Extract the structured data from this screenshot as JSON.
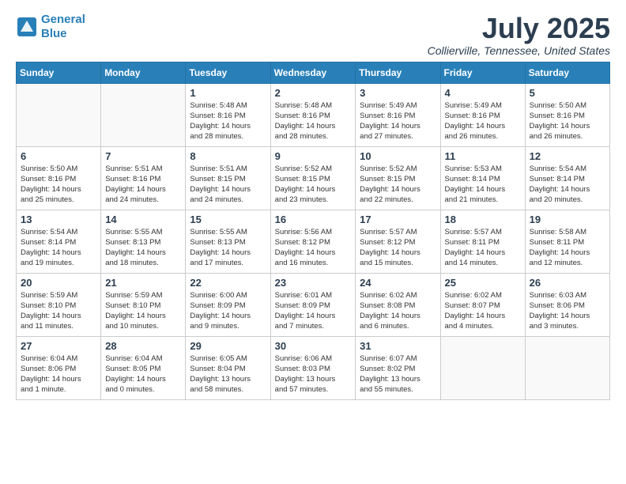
{
  "header": {
    "logo_line1": "General",
    "logo_line2": "Blue",
    "month_title": "July 2025",
    "location": "Collierville, Tennessee, United States"
  },
  "days_of_week": [
    "Sunday",
    "Monday",
    "Tuesday",
    "Wednesday",
    "Thursday",
    "Friday",
    "Saturday"
  ],
  "weeks": [
    [
      {
        "num": "",
        "info": ""
      },
      {
        "num": "",
        "info": ""
      },
      {
        "num": "1",
        "info": "Sunrise: 5:48 AM\nSunset: 8:16 PM\nDaylight: 14 hours\nand 28 minutes."
      },
      {
        "num": "2",
        "info": "Sunrise: 5:48 AM\nSunset: 8:16 PM\nDaylight: 14 hours\nand 28 minutes."
      },
      {
        "num": "3",
        "info": "Sunrise: 5:49 AM\nSunset: 8:16 PM\nDaylight: 14 hours\nand 27 minutes."
      },
      {
        "num": "4",
        "info": "Sunrise: 5:49 AM\nSunset: 8:16 PM\nDaylight: 14 hours\nand 26 minutes."
      },
      {
        "num": "5",
        "info": "Sunrise: 5:50 AM\nSunset: 8:16 PM\nDaylight: 14 hours\nand 26 minutes."
      }
    ],
    [
      {
        "num": "6",
        "info": "Sunrise: 5:50 AM\nSunset: 8:16 PM\nDaylight: 14 hours\nand 25 minutes."
      },
      {
        "num": "7",
        "info": "Sunrise: 5:51 AM\nSunset: 8:16 PM\nDaylight: 14 hours\nand 24 minutes."
      },
      {
        "num": "8",
        "info": "Sunrise: 5:51 AM\nSunset: 8:15 PM\nDaylight: 14 hours\nand 24 minutes."
      },
      {
        "num": "9",
        "info": "Sunrise: 5:52 AM\nSunset: 8:15 PM\nDaylight: 14 hours\nand 23 minutes."
      },
      {
        "num": "10",
        "info": "Sunrise: 5:52 AM\nSunset: 8:15 PM\nDaylight: 14 hours\nand 22 minutes."
      },
      {
        "num": "11",
        "info": "Sunrise: 5:53 AM\nSunset: 8:14 PM\nDaylight: 14 hours\nand 21 minutes."
      },
      {
        "num": "12",
        "info": "Sunrise: 5:54 AM\nSunset: 8:14 PM\nDaylight: 14 hours\nand 20 minutes."
      }
    ],
    [
      {
        "num": "13",
        "info": "Sunrise: 5:54 AM\nSunset: 8:14 PM\nDaylight: 14 hours\nand 19 minutes."
      },
      {
        "num": "14",
        "info": "Sunrise: 5:55 AM\nSunset: 8:13 PM\nDaylight: 14 hours\nand 18 minutes."
      },
      {
        "num": "15",
        "info": "Sunrise: 5:55 AM\nSunset: 8:13 PM\nDaylight: 14 hours\nand 17 minutes."
      },
      {
        "num": "16",
        "info": "Sunrise: 5:56 AM\nSunset: 8:12 PM\nDaylight: 14 hours\nand 16 minutes."
      },
      {
        "num": "17",
        "info": "Sunrise: 5:57 AM\nSunset: 8:12 PM\nDaylight: 14 hours\nand 15 minutes."
      },
      {
        "num": "18",
        "info": "Sunrise: 5:57 AM\nSunset: 8:11 PM\nDaylight: 14 hours\nand 14 minutes."
      },
      {
        "num": "19",
        "info": "Sunrise: 5:58 AM\nSunset: 8:11 PM\nDaylight: 14 hours\nand 12 minutes."
      }
    ],
    [
      {
        "num": "20",
        "info": "Sunrise: 5:59 AM\nSunset: 8:10 PM\nDaylight: 14 hours\nand 11 minutes."
      },
      {
        "num": "21",
        "info": "Sunrise: 5:59 AM\nSunset: 8:10 PM\nDaylight: 14 hours\nand 10 minutes."
      },
      {
        "num": "22",
        "info": "Sunrise: 6:00 AM\nSunset: 8:09 PM\nDaylight: 14 hours\nand 9 minutes."
      },
      {
        "num": "23",
        "info": "Sunrise: 6:01 AM\nSunset: 8:09 PM\nDaylight: 14 hours\nand 7 minutes."
      },
      {
        "num": "24",
        "info": "Sunrise: 6:02 AM\nSunset: 8:08 PM\nDaylight: 14 hours\nand 6 minutes."
      },
      {
        "num": "25",
        "info": "Sunrise: 6:02 AM\nSunset: 8:07 PM\nDaylight: 14 hours\nand 4 minutes."
      },
      {
        "num": "26",
        "info": "Sunrise: 6:03 AM\nSunset: 8:06 PM\nDaylight: 14 hours\nand 3 minutes."
      }
    ],
    [
      {
        "num": "27",
        "info": "Sunrise: 6:04 AM\nSunset: 8:06 PM\nDaylight: 14 hours\nand 1 minute."
      },
      {
        "num": "28",
        "info": "Sunrise: 6:04 AM\nSunset: 8:05 PM\nDaylight: 14 hours\nand 0 minutes."
      },
      {
        "num": "29",
        "info": "Sunrise: 6:05 AM\nSunset: 8:04 PM\nDaylight: 13 hours\nand 58 minutes."
      },
      {
        "num": "30",
        "info": "Sunrise: 6:06 AM\nSunset: 8:03 PM\nDaylight: 13 hours\nand 57 minutes."
      },
      {
        "num": "31",
        "info": "Sunrise: 6:07 AM\nSunset: 8:02 PM\nDaylight: 13 hours\nand 55 minutes."
      },
      {
        "num": "",
        "info": ""
      },
      {
        "num": "",
        "info": ""
      }
    ]
  ]
}
